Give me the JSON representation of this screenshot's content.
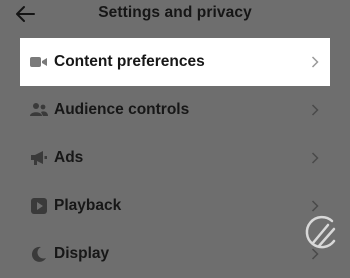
{
  "header": {
    "title": "Settings and privacy"
  },
  "menu": [
    {
      "label": "Content preferences",
      "icon": "video-camera-icon",
      "highlighted": true
    },
    {
      "label": "Audience controls",
      "icon": "people-icon",
      "highlighted": false
    },
    {
      "label": "Ads",
      "icon": "megaphone-icon",
      "highlighted": false
    },
    {
      "label": "Playback",
      "icon": "play-icon",
      "highlighted": false
    },
    {
      "label": "Display",
      "icon": "moon-icon",
      "highlighted": false
    }
  ],
  "colors": {
    "overlay": "#6e6e6e",
    "highlight": "#ffffff",
    "text": "#161616"
  }
}
